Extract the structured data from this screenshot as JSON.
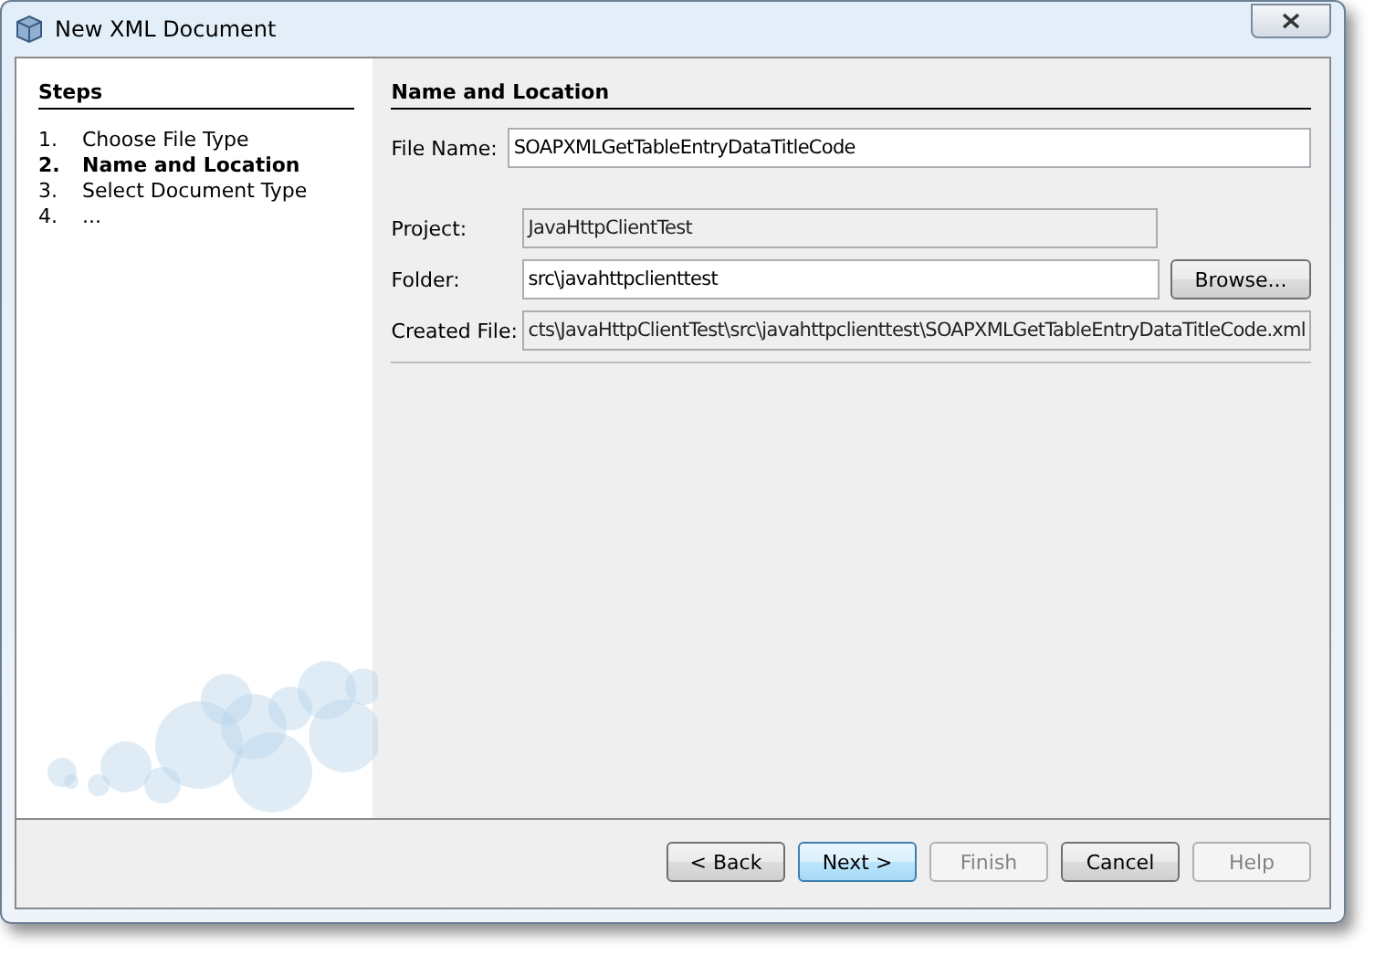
{
  "window": {
    "title": "New XML Document"
  },
  "steps": {
    "title": "Steps",
    "items": [
      {
        "number": "1.",
        "label": "Choose File Type",
        "selected": false
      },
      {
        "number": "2.",
        "label": "Name and Location",
        "selected": true
      },
      {
        "number": "3.",
        "label": "Select Document Type",
        "selected": false
      },
      {
        "number": "4.",
        "label": "...",
        "selected": false
      }
    ]
  },
  "panel": {
    "title": "Name and Location",
    "fields": [
      {
        "label": "File Name:",
        "value": "SOAPXMLGetTableEntryDataTitleCode",
        "editable": true
      },
      {
        "label": "Project:",
        "value": "JavaHttpClientTest",
        "editable": false
      },
      {
        "label": "Folder:",
        "value": "src\\javahttpclienttest",
        "editable": true,
        "button": "Browse..."
      },
      {
        "label": "Created File:",
        "value": "cts\\JavaHttpClientTest\\src\\javahttpclienttest\\SOAPXMLGetTableEntryDataTitleCode.xml",
        "editable": false
      }
    ]
  },
  "buttons": [
    {
      "label": "< Back",
      "disabled": false,
      "default": false
    },
    {
      "label": "Next >",
      "disabled": false,
      "default": true
    },
    {
      "label": "Finish",
      "disabled": true,
      "default": false
    },
    {
      "label": "Cancel",
      "disabled": false,
      "default": false
    },
    {
      "label": "Help",
      "disabled": true,
      "default": false
    }
  ]
}
